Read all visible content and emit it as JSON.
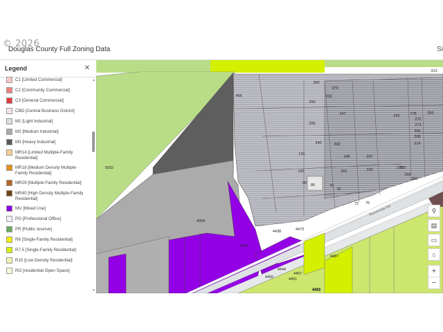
{
  "watermark": "© 2026",
  "app": {
    "title": "Douglas County Full Zoning Data",
    "header_right": "Si"
  },
  "legend": {
    "title": "Legend",
    "close_icon": "close-icon",
    "items": [
      {
        "label": "C1 [Limited Commercial]",
        "color": "#f4b4b4",
        "hatch": true
      },
      {
        "label": "C2 [Community Commercial]",
        "color": "#f08080",
        "hatch": false
      },
      {
        "label": "C3 [General Commercial]",
        "color": "#e8393f",
        "hatch": false
      },
      {
        "label": "CBD [Central Business District]",
        "color": "#f7d6d6",
        "hatch": true
      },
      {
        "label": "M1 [Light Industrial]",
        "color": "#dedede",
        "hatch": false
      },
      {
        "label": "M2 [Medium Industrial]",
        "color": "#a9a9a9",
        "hatch": false
      },
      {
        "label": "M3 [Heavy Industrial]",
        "color": "#5a5a5a",
        "hatch": false
      },
      {
        "label": "MR14 [Limited Multiple-Family Residential]",
        "color": "#f6cf8f",
        "hatch": false
      },
      {
        "label": "MR18 [Medium Density Multiple-Family Residential]",
        "color": "#e58f1c",
        "hatch": false
      },
      {
        "label": "MR29 [Multiple-Family Residential]",
        "color": "#b7651f",
        "hatch": false
      },
      {
        "label": "MR40 [High Density Multiple-Family Residential]",
        "color": "#6e4314",
        "hatch": false
      },
      {
        "label": "MU [Mixed Use]",
        "color": "#8a00e6",
        "hatch": false
      },
      {
        "label": "PO [Professional Office]",
        "color": "#f3eff7",
        "hatch": false
      },
      {
        "label": "PR [Public reserve]",
        "color": "#6aaa5a",
        "hatch": false
      },
      {
        "label": "R6 [Single-Family Residential]",
        "color": "#f2ee00",
        "hatch": false
      },
      {
        "label": "R7.5 [Single-Family Residential]",
        "color": "#d7f000",
        "hatch": false
      },
      {
        "label": "R10 [Low Density Residential]",
        "color": "#f4f2b0",
        "hatch": false
      },
      {
        "label": "RO [residential Open Space]",
        "color": "#fbf7dd",
        "hatch": false
      }
    ]
  },
  "map": {
    "parcel_labels": [
      "313",
      "300",
      "279",
      "466",
      "252",
      "250",
      "247",
      "262",
      "278",
      "356",
      "272",
      "273",
      "206",
      "305",
      "308",
      "314",
      "340",
      "303",
      "131",
      "140",
      "292",
      "267",
      "125",
      "120",
      "301",
      "290",
      "256",
      "260",
      "90",
      "75",
      "80",
      "79",
      "72",
      "76",
      "5932",
      "4094",
      "4438",
      "4473",
      "4192",
      "4487",
      "4467",
      "4451",
      "4453",
      "4450",
      "4444",
      "4483"
    ],
    "road_label": "Beaverdale Rd",
    "zoning_colors": {
      "r75": "#cde66e",
      "r75_bright": "#d4f000",
      "pr": "#b9dd86",
      "m1": "#c6c6cc",
      "m2": "#b0b0b0",
      "m3": "#5e5e5e",
      "mu": "#9400e6",
      "mr40": "#6e4e4e",
      "road": "#dfe2e5"
    }
  },
  "tools": {
    "search_icon": "search-icon",
    "basemap_icon": "basemap-icon",
    "screen_icon": "fullscreen-icon",
    "home_icon": "home-icon",
    "zoom_in": "+",
    "zoom_out": "−"
  }
}
